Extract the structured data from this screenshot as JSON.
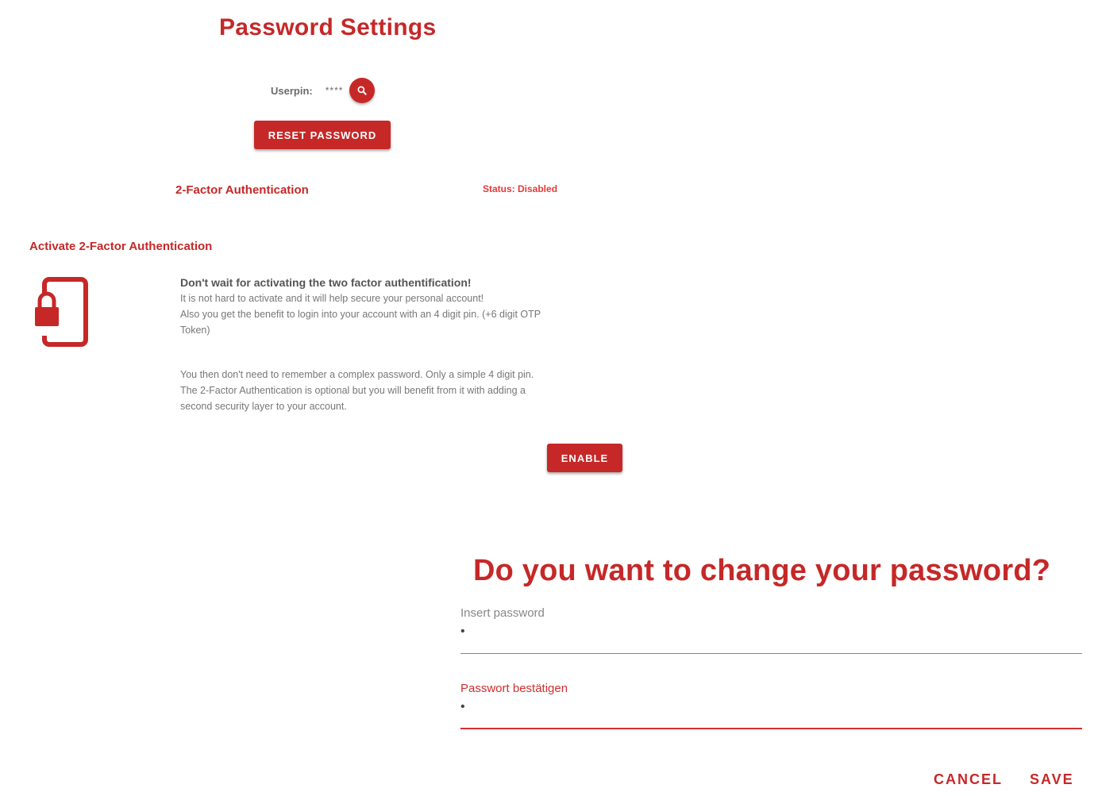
{
  "settings": {
    "title": "Password Settings",
    "userpin_label": "Userpin:",
    "userpin_value": "****",
    "reset_button": "RESET PASSWORD",
    "tfa_label": "2-Factor Authentication",
    "tfa_status": "Status: Disabled",
    "activate_heading": "Activate 2-Factor Authentication",
    "info_title": "Don't wait for activating the two factor authentification!",
    "info_lines_1": [
      "It is not hard to activate and it will help secure your personal account!",
      "Also you get the benefit to login into your account with an 4 digit pin. (+6 digit OTP",
      "Token)"
    ],
    "info_lines_2": [
      "You then don't need to remember a complex password. Only a simple 4 digit pin.",
      "The 2-Factor Authentication is optional but you will benefit from it with adding a",
      "second security layer to your account."
    ],
    "enable_button": "ENABLE"
  },
  "dialog": {
    "title": "Do you want to change your password?",
    "password_label": "Insert password",
    "password_value": "•",
    "confirm_label": "Passwort bestätigen",
    "confirm_value": "•",
    "cancel_button": "CANCEL",
    "save_button": "SAVE"
  },
  "icons": {
    "search": "search-icon",
    "phone_lock": "phone-lock-icon"
  },
  "colors": {
    "accent": "#c62828",
    "status": "#e53935",
    "text": "#555555",
    "muted": "#777777"
  }
}
